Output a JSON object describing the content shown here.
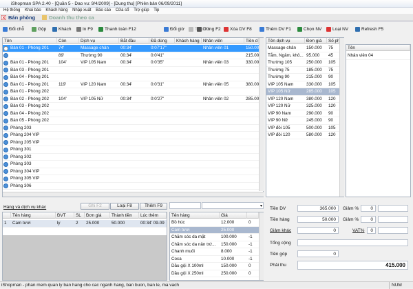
{
  "window": {
    "title": "iShopman SPA 2.40 - [Quần 5 - Dao vu: 9/4/2009] - [Dung thu] [Phiên bản 06/09/2011]"
  },
  "menu": [
    "Hệ thống",
    "Khai báo",
    "Khách hàng",
    "Nhập xuất",
    "Báo cáo",
    "Cửa sổ",
    "Trợ giúp",
    "Tip"
  ],
  "tabs": [
    {
      "label": "Bán phòng",
      "active": true
    },
    {
      "label": "Doanh thu theo ca",
      "active": false
    }
  ],
  "toolbar": {
    "doi_cho": "Đổi chỗ",
    "gop": "Gộp",
    "khach": "Khách",
    "in": "In F9",
    "thanh_toan": "Thanh toán F12",
    "doi_gio": "Đổi giờ",
    "tiep": "Tiếp F3",
    "dung": "Dừng F2",
    "xoa_dv": "Xóa DV F8",
    "them_dv": "Thêm DV F1",
    "chon_nv": "Chọn NV",
    "loai_nv": "Loại NV",
    "refresh": "Refresh F5"
  },
  "rooms": {
    "columns": [
      "Tên",
      "Còn",
      "Dịch vụ",
      "Bắt đầu",
      "Đã dùng",
      "Khách hàng",
      "Nhân viên",
      "Tiền d"
    ],
    "rows": [
      {
        "name": "Bàn 01 - Phòng 201",
        "con": "74'",
        "service": "Massage chân",
        "start": "00:34'",
        "used": "0:07'17\"",
        "customer": "",
        "staff": "Nhân viên 01",
        "money": "150.00",
        "busy": true,
        "selected": true
      },
      {
        "name": "",
        "con": "89'",
        "service": "Thường 90",
        "start": "00:34'",
        "used": "0:0'41\"",
        "customer": "",
        "staff": "",
        "money": "215.00",
        "busy": false,
        "selected": false
      },
      {
        "name": "Bàn 01 - Phòng 201",
        "con": "104'",
        "service": "VIP 105 Nam",
        "start": "00:34'",
        "used": "0:0'35\"",
        "customer": "",
        "staff": "Nhân viên 03",
        "money": "330.00",
        "busy": false,
        "selected": false
      },
      {
        "name": "Bàn 03 - Phòng 201",
        "con": "",
        "service": "",
        "start": "",
        "used": "",
        "customer": "",
        "staff": "",
        "money": "",
        "busy": false,
        "selected": false
      },
      {
        "name": "Bàn 04 - Phòng 201",
        "con": "",
        "service": "",
        "start": "",
        "used": "",
        "customer": "",
        "staff": "",
        "money": "",
        "busy": false,
        "selected": false
      },
      {
        "name": "Bàn 01 - Phòng 201",
        "con": "119'",
        "service": "VIP 120 Nam",
        "start": "00:34'",
        "used": "0:0'31\"",
        "customer": "",
        "staff": "Nhân viên 05",
        "money": "380.00",
        "busy": false,
        "selected": false
      },
      {
        "name": "Bàn 01 - Phòng 202",
        "con": "",
        "service": "",
        "start": "",
        "used": "",
        "customer": "",
        "staff": "",
        "money": "",
        "busy": false,
        "selected": false
      },
      {
        "name": "Bàn 02 - Phòng 202",
        "con": "104'",
        "service": "VIP 105 Nữ",
        "start": "00:34'",
        "used": "0:0'27\"",
        "customer": "",
        "staff": "Nhân viên 02",
        "money": "285.00",
        "busy": false,
        "selected": false
      },
      {
        "name": "Bàn 03 - Phòng 202",
        "con": "",
        "service": "",
        "start": "",
        "used": "",
        "customer": "",
        "staff": "",
        "money": "",
        "busy": false,
        "selected": false
      },
      {
        "name": "Bàn 04 - Phòng 202",
        "con": "",
        "service": "",
        "start": "",
        "used": "",
        "customer": "",
        "staff": "",
        "money": "",
        "busy": false,
        "selected": false
      },
      {
        "name": "Bàn 05 - Phòng 202",
        "con": "",
        "service": "",
        "start": "",
        "used": "",
        "customer": "",
        "staff": "",
        "money": "",
        "busy": false,
        "selected": false
      },
      {
        "name": "Phòng 203",
        "con": "",
        "service": "",
        "start": "",
        "used": "",
        "customer": "",
        "staff": "",
        "money": "",
        "busy": false,
        "selected": false
      },
      {
        "name": "Phòng 204 VIP",
        "con": "",
        "service": "",
        "start": "",
        "used": "",
        "customer": "",
        "staff": "",
        "money": "",
        "busy": false,
        "selected": false
      },
      {
        "name": "Phòng 205 VIP",
        "con": "",
        "service": "",
        "start": "",
        "used": "",
        "customer": "",
        "staff": "",
        "money": "",
        "busy": false,
        "selected": false
      },
      {
        "name": "Phòng 301",
        "con": "",
        "service": "",
        "start": "",
        "used": "",
        "customer": "",
        "staff": "",
        "money": "",
        "busy": false,
        "selected": false
      },
      {
        "name": "Phòng 302",
        "con": "",
        "service": "",
        "start": "",
        "used": "",
        "customer": "",
        "staff": "",
        "money": "",
        "busy": false,
        "selected": false
      },
      {
        "name": "Phòng 303",
        "con": "",
        "service": "",
        "start": "",
        "used": "",
        "customer": "",
        "staff": "",
        "money": "",
        "busy": false,
        "selected": false
      },
      {
        "name": "Phòng 304 VIP",
        "con": "",
        "service": "",
        "start": "",
        "used": "",
        "customer": "",
        "staff": "",
        "money": "",
        "busy": false,
        "selected": false
      },
      {
        "name": "Phòng 305 VIP",
        "con": "",
        "service": "",
        "start": "",
        "used": "",
        "customer": "",
        "staff": "",
        "money": "",
        "busy": false,
        "selected": false
      },
      {
        "name": "Phòng 306",
        "con": "",
        "service": "",
        "start": "",
        "used": "",
        "customer": "",
        "staff": "",
        "money": "",
        "busy": false,
        "selected": false
      }
    ]
  },
  "services": {
    "columns": [
      "Tên dịch vụ",
      "Đơn giá",
      "Số phú"
    ],
    "rows": [
      {
        "name": "Massage chân",
        "price": "150.000",
        "min": "75"
      },
      {
        "name": "Tắm, Ngâm, khô...",
        "price": "95.000",
        "min": "45"
      },
      {
        "name": "Thường 105",
        "price": "250.000",
        "min": "105"
      },
      {
        "name": "Thường 75",
        "price": "185.000",
        "min": "75"
      },
      {
        "name": "Thường 90",
        "price": "215.000",
        "min": "90"
      },
      {
        "name": "VIP 105 Nam",
        "price": "330.000",
        "min": "105"
      },
      {
        "name": "VIP 105 Nữ",
        "price": "285.000",
        "min": "105",
        "selected": true
      },
      {
        "name": "VIP 120 Nam",
        "price": "380.000",
        "min": "120"
      },
      {
        "name": "VIP 120 Nữ",
        "price": "325.000",
        "min": "120"
      },
      {
        "name": "VIP 90 Nam",
        "price": "290.000",
        "min": "90"
      },
      {
        "name": "VIP 90 Nữ",
        "price": "245.000",
        "min": "90"
      },
      {
        "name": "VIP đôi 105",
        "price": "500.000",
        "min": "105"
      },
      {
        "name": "VIP đôi 120",
        "price": "580.000",
        "min": "120"
      }
    ]
  },
  "staff": {
    "column": "Tên",
    "rows": [
      "Nhân viên 04"
    ]
  },
  "goods": {
    "title": "Hàng và dịch vụ khác",
    "btn_ghi": "Ghi F2",
    "btn_loai": "Loại F8",
    "btn_them": "Thêm F9",
    "columns": [
      "",
      "Tên hàng",
      "ĐVT",
      "SL",
      "Đơn giá",
      "Thành tiền",
      "Lúc thêm"
    ],
    "rows": [
      {
        "no": "1",
        "name": "Cam tươi",
        "unit": "ly",
        "qty": "2",
        "price": "25.000",
        "total": "50.000",
        "time": "00:34' 09-09"
      }
    ]
  },
  "product_list": {
    "columns": [
      "Tên hàng",
      "Giá"
    ],
    "rows": [
      {
        "name": "Bồ húc",
        "price": "12.000",
        "qty": "0"
      },
      {
        "name": "Cam tươi",
        "price": "25.000",
        "qty": "",
        "selected": true
      },
      {
        "name": "Chăm sóc da mặt",
        "price": "100.000",
        "qty": "-1"
      },
      {
        "name": "Chăm sóc da nân trứ...",
        "price": "150.000",
        "qty": "-1"
      },
      {
        "name": "Chanh muối",
        "price": "8.000",
        "qty": "-1"
      },
      {
        "name": "Coca",
        "price": "10.000",
        "qty": "-1"
      },
      {
        "name": "Dầu gội X 100ml",
        "price": "150.000",
        "qty": "0"
      },
      {
        "name": "Dầu gội X 250ml",
        "price": "250.000",
        "qty": "0"
      }
    ]
  },
  "totals": {
    "tien_dv_label": "Tiền DV",
    "tien_dv": "365.000",
    "giam1_label": "Giảm %",
    "giam1": "0",
    "tien_hang_label": "Tiền hàng",
    "tien_hang": "50.000",
    "giam2_label": "Giảm %",
    "giam2": "0",
    "giam_khac_label": "Giảm khác",
    "giam_khac": "0",
    "vat_label": "VAT%",
    "vat": "0",
    "tong_cong_label": "Tổng cộng",
    "tien_gop_label": "Tiền góp",
    "tien_gop": "0",
    "phai_thu_label": "Phải thu",
    "phai_thu": "415.000"
  },
  "status": {
    "text": "iShopman - phan mem quan ly ban hang cho cac nganh hang, ban buon, ban le, ma vach",
    "num": "NUM"
  },
  "colors": {
    "selection": "#3399ff",
    "accent": "#1a3d7a"
  }
}
